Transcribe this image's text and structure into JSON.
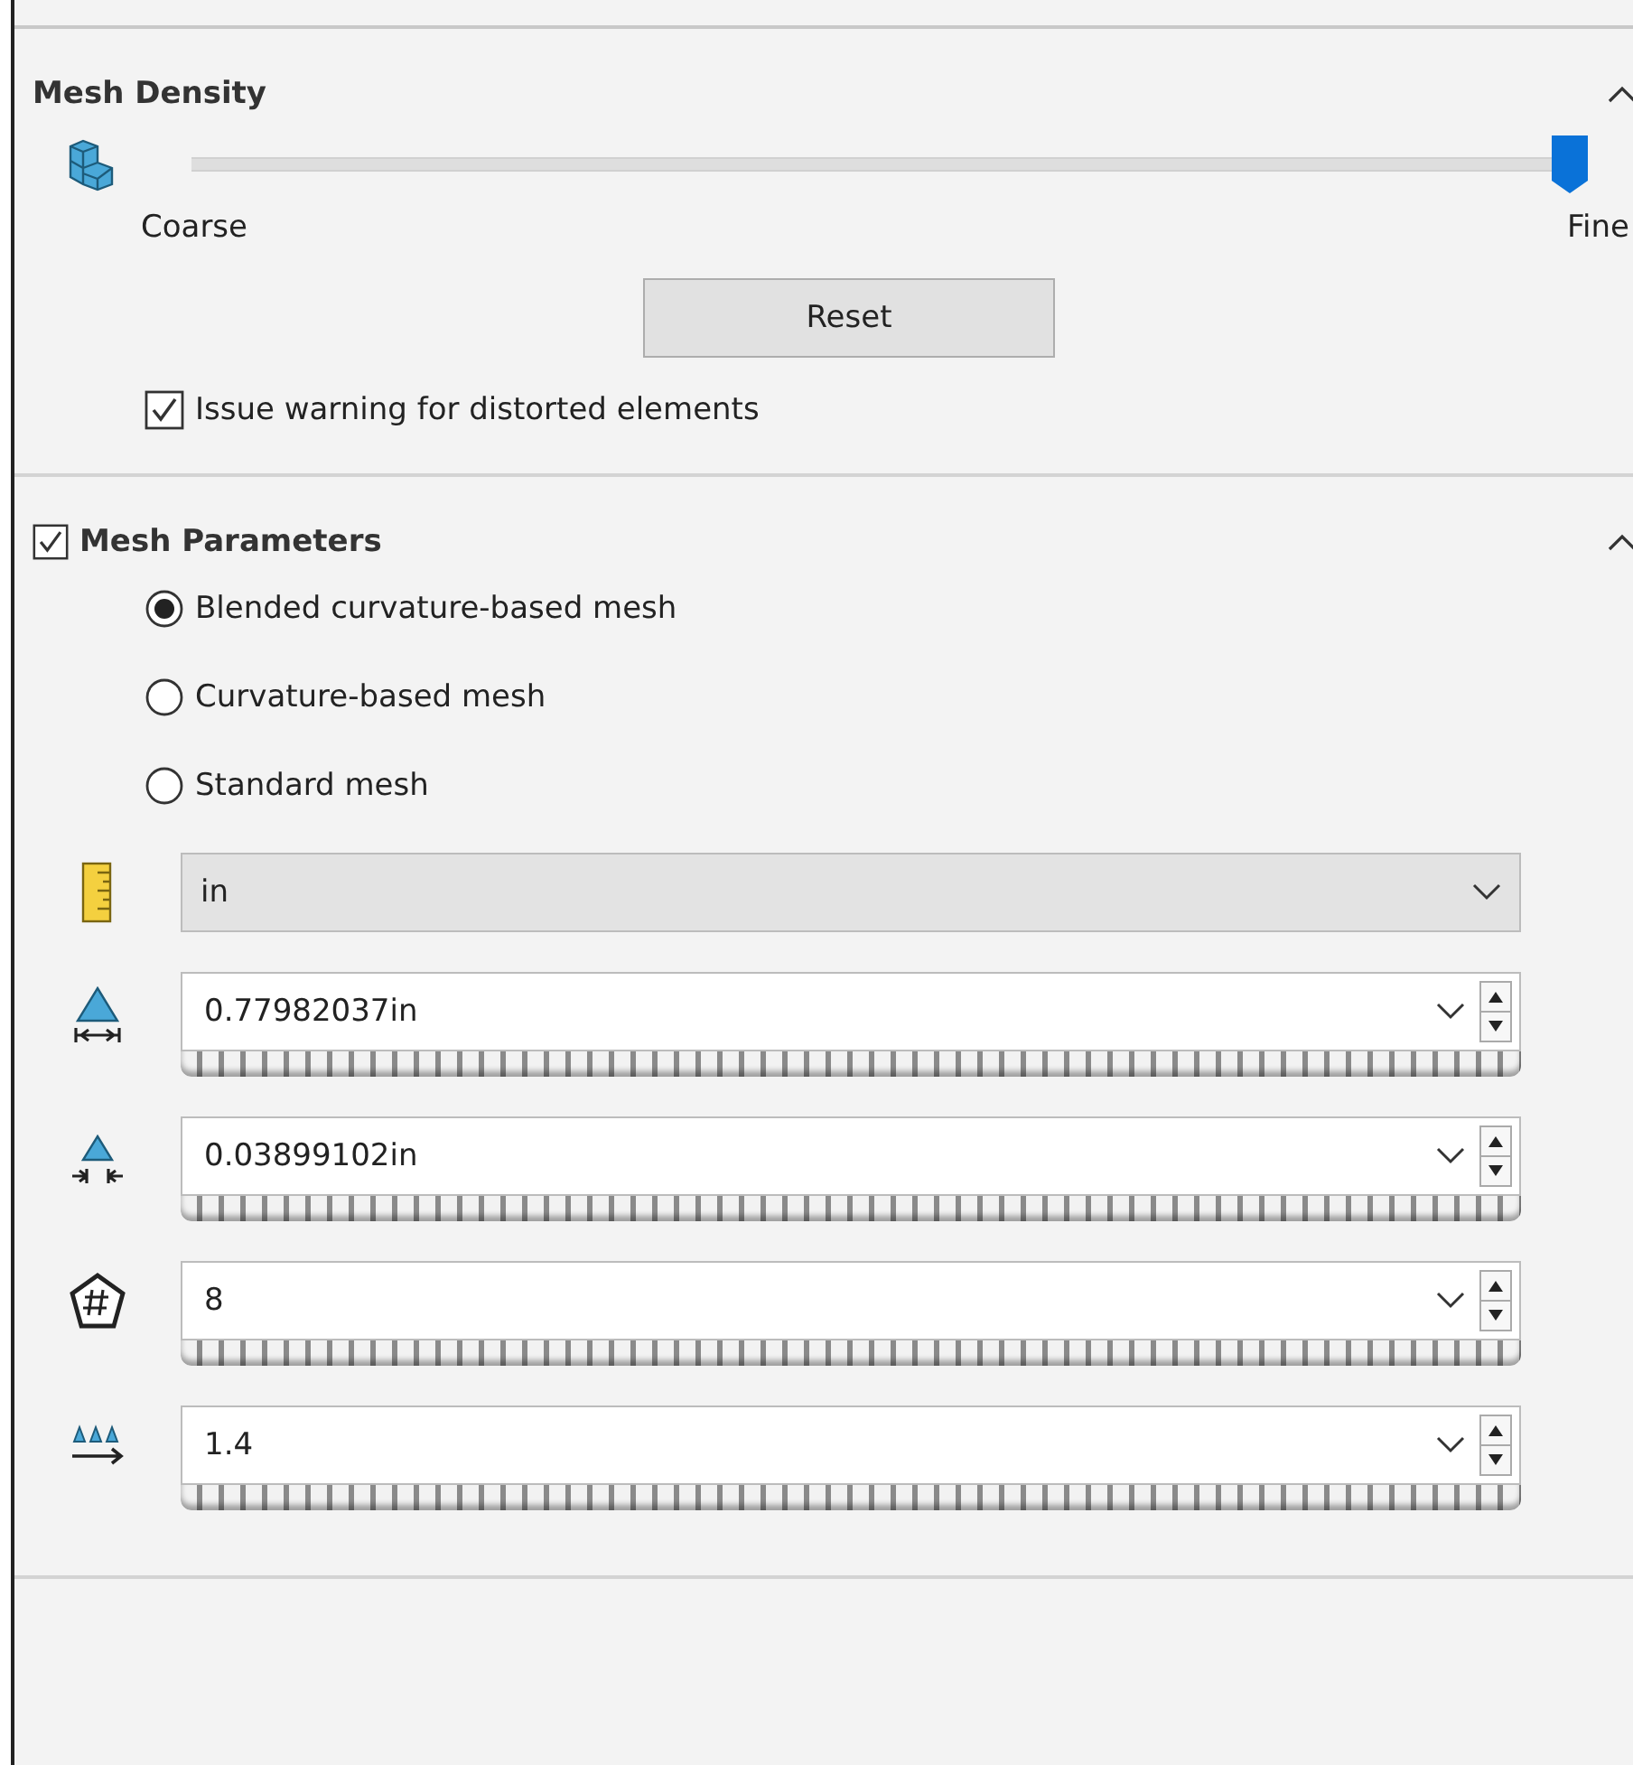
{
  "mesh_density": {
    "title": "Mesh Density",
    "expanded": true,
    "level": 1,
    "min_label": "Coarse",
    "max_label": "Fine",
    "reset": "Reset",
    "warning": {
      "label": "Issue warning for distorted elements",
      "checked": true
    }
  },
  "mesh_parameters": {
    "title": "Mesh Parameters",
    "checked": true,
    "expanded": true,
    "options": [
      {
        "label": "Blended curvature-based mesh",
        "selected": true
      },
      {
        "label": "Curvature-based mesh",
        "selected": false
      },
      {
        "label": "Standard mesh",
        "selected": false
      }
    ],
    "units": {
      "value": "in"
    },
    "fields": [
      {
        "value": "0.77982037in"
      },
      {
        "value": "0.03899102in"
      },
      {
        "value": "8"
      },
      {
        "value": "1.4"
      }
    ]
  }
}
